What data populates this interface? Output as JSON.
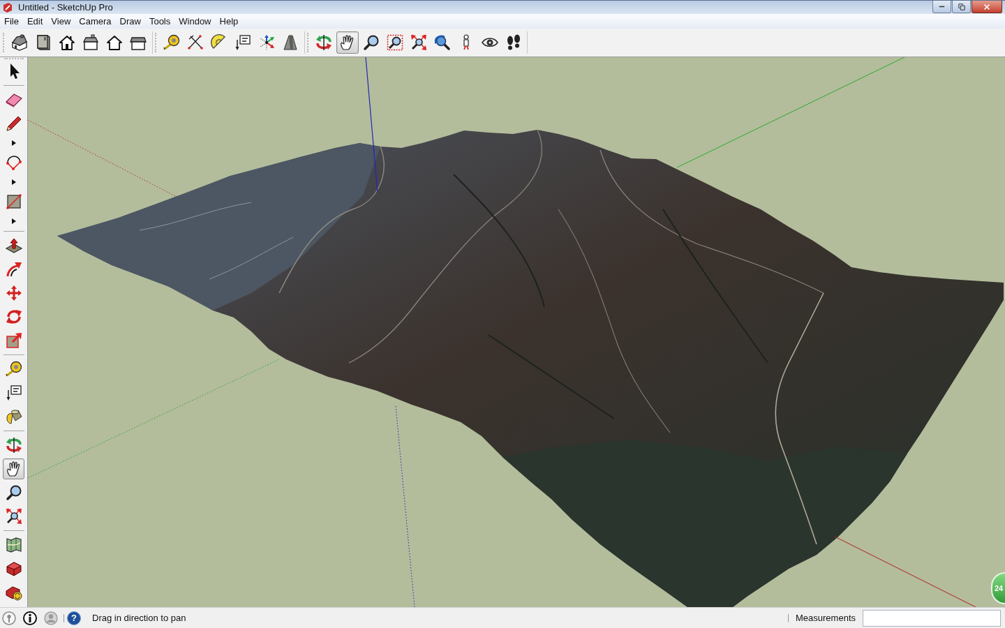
{
  "window": {
    "title": "Untitled - SketchUp Pro"
  },
  "menu": [
    "File",
    "Edit",
    "View",
    "Camera",
    "Draw",
    "Tools",
    "Window",
    "Help"
  ],
  "toolbar": [
    [
      {
        "kind": "iso",
        "selected": false
      },
      {
        "kind": "top",
        "selected": false
      },
      {
        "kind": "front",
        "selected": false
      },
      {
        "kind": "right",
        "selected": false
      },
      {
        "kind": "back",
        "selected": false
      },
      {
        "kind": "left",
        "selected": false
      }
    ],
    [
      {
        "kind": "tape",
        "selected": false
      },
      {
        "kind": "dimension",
        "selected": false
      },
      {
        "kind": "protractor",
        "selected": false
      },
      {
        "kind": "text",
        "selected": false
      },
      {
        "kind": "axes",
        "selected": false
      },
      {
        "kind": "text3d",
        "selected": false
      }
    ],
    [
      {
        "kind": "orbit",
        "selected": false
      },
      {
        "kind": "pan",
        "selected": true
      },
      {
        "kind": "zoom",
        "selected": false
      },
      {
        "kind": "zoomwindow",
        "selected": false
      },
      {
        "kind": "zoomextents",
        "selected": false
      },
      {
        "kind": "previous",
        "selected": false
      },
      {
        "kind": "position",
        "selected": false
      },
      {
        "kind": "lookaround",
        "selected": false
      },
      {
        "kind": "walk",
        "selected": false
      }
    ]
  ],
  "side_toolbar": [
    [
      {
        "kind": "select",
        "selected": false
      }
    ],
    [
      {
        "kind": "eraser",
        "selected": false
      },
      {
        "kind": "pencil",
        "selected": false
      },
      {
        "kind": "flyout",
        "selected": false
      },
      {
        "kind": "arc",
        "selected": false
      },
      {
        "kind": "flyout",
        "selected": false
      },
      {
        "kind": "rectangle",
        "selected": false
      },
      {
        "kind": "flyout",
        "selected": false
      }
    ],
    [
      {
        "kind": "pushpull",
        "selected": false
      },
      {
        "kind": "followme",
        "selected": false
      },
      {
        "kind": "move",
        "selected": false
      },
      {
        "kind": "rotate",
        "selected": false
      },
      {
        "kind": "scale",
        "selected": false
      }
    ],
    [
      {
        "kind": "tape",
        "selected": false
      },
      {
        "kind": "text",
        "selected": false
      },
      {
        "kind": "paint",
        "selected": false
      }
    ],
    [
      {
        "kind": "orbit",
        "selected": false
      },
      {
        "kind": "pan",
        "selected": true
      },
      {
        "kind": "zoom",
        "selected": false
      },
      {
        "kind": "zoomextents",
        "selected": false
      }
    ],
    [
      {
        "kind": "map",
        "selected": false
      },
      {
        "kind": "warehouse",
        "selected": false
      },
      {
        "kind": "extension",
        "selected": false
      }
    ]
  ],
  "floating_badge": {
    "text": "24"
  },
  "status_bar": {
    "help_label": "?",
    "hint": "Drag in direction to pan",
    "measurements_label": "Measurements"
  }
}
